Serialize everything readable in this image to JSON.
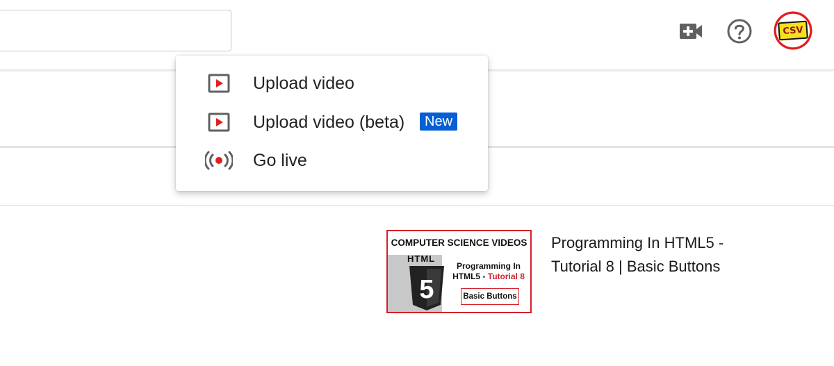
{
  "header": {
    "search": {
      "placeholder": "",
      "value": ""
    },
    "icons": {
      "create": "video-camera-plus-icon",
      "help": "question-mark-icon"
    },
    "avatar_text": "CSV"
  },
  "create_menu": {
    "items": [
      {
        "label": "Upload video",
        "icon": "upload-video-icon"
      },
      {
        "label": "Upload video (beta)",
        "icon": "upload-video-icon",
        "badge": "New"
      },
      {
        "label": "Go live",
        "icon": "live-broadcast-icon"
      }
    ]
  },
  "video": {
    "title": "Programming In HTML5 - Tutorial 8 | Basic Buttons",
    "thumbnail": {
      "channel_title": "COMPUTER SCIENCE VIDEOS",
      "logo_text": "HTML",
      "shield_digit": "5",
      "line1": "Programming In",
      "line2_prefix": "HTML5 - ",
      "line2_highlight": "Tutorial 8",
      "button_text": "Basic Buttons"
    }
  },
  "colors": {
    "accent_red": "#d4202a",
    "badge_blue": "#065fd4",
    "icon_gray": "#606060"
  }
}
